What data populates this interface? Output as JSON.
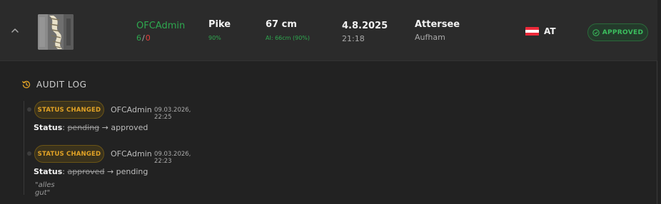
{
  "catch": {
    "user": "OFCAdmin",
    "votes_up": "6",
    "votes_separator": "/",
    "votes_down": "0",
    "species": "Pike",
    "species_confidence": "90%",
    "length": "67 cm",
    "ai_length": "AI: 66cm (90%)",
    "date": "4.8.2025",
    "time": "21:18",
    "water": "Attersee",
    "location": "Aufham",
    "country_code": "AT",
    "status": "APPROVED"
  },
  "audit": {
    "title": "AUDIT LOG",
    "entries": [
      {
        "badge": "STATUS CHANGED",
        "actor": "OFCAdmin",
        "timestamp": "09.03.2026, 22:25",
        "field": "Status",
        "from": "pending",
        "arrow": "→",
        "to": "approved"
      },
      {
        "badge": "STATUS CHANGED",
        "actor": "OFCAdmin",
        "timestamp": "09.03.2026, 22:23",
        "field": "Status",
        "from": "approved",
        "arrow": "→",
        "to": "pending",
        "comment": "\"alles gut\""
      }
    ]
  },
  "colors": {
    "green": "#2ea84f",
    "red": "#e2403b",
    "amber": "#e1a226",
    "flag_red": "#ed2939",
    "flag_white": "#ffffff"
  },
  "icons": {
    "expand": "chevron-up-icon",
    "status": "check-circle-icon",
    "audit": "history-icon"
  }
}
